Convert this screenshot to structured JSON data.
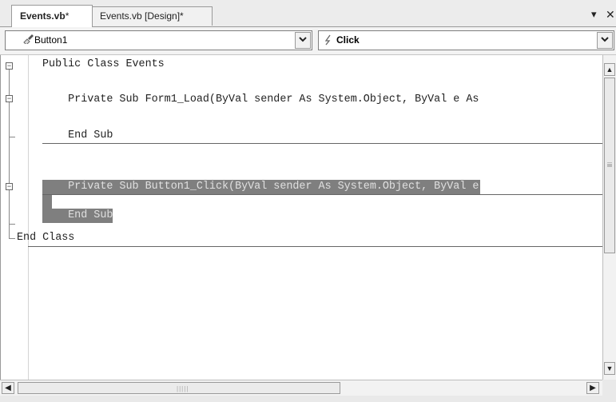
{
  "tabs": [
    {
      "label": "Events.vb",
      "dirty_marker": "*",
      "active": true
    },
    {
      "label": "Events.vb [Design]*",
      "active": false
    }
  ],
  "tabstrip_controls": {
    "dropdown_glyph": "▾",
    "close_glyph": "✕"
  },
  "navbar": {
    "object_combo": {
      "icon": "button-control-icon",
      "value": "Button1"
    },
    "event_combo": {
      "icon": "lightning-event-icon",
      "value": "Click"
    }
  },
  "code_lines": [
    "Public Class Events",
    "    Private Sub Form1_Load(ByVal sender As System.Object, ByVal e As",
    "    End Sub",
    "    Private Sub Button1_Click(ByVal sender As System.Object, ByVal e",
    "    End Sub",
    "End Class"
  ],
  "scrollbar_glyphs": {
    "up": "▲",
    "down": "▼",
    "left": "◀",
    "right": "▶",
    "hgrip": "|||||"
  },
  "colors": {
    "selection": "#7f7f7f",
    "editor_bg": "#ffffff",
    "chrome_bg": "#ececec"
  }
}
